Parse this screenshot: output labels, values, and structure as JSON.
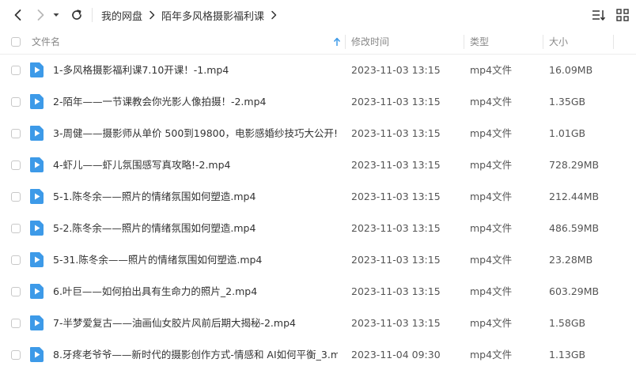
{
  "breadcrumb": [
    "我的网盘",
    "陌年多风格摄影福利课"
  ],
  "header": {
    "name": "文件名",
    "time": "修改时间",
    "type": "类型",
    "size": "大小"
  },
  "colors": {
    "file_icon": "#3d9ae8",
    "text": "#333333",
    "header_text": "#888888"
  },
  "icons": {
    "back": "chevron-left-icon",
    "forward": "chevron-right-icon",
    "history": "dropdown-icon",
    "refresh": "refresh-icon",
    "sort": "sort-list-icon",
    "file": "video-file-icon"
  },
  "files": [
    {
      "name": "1-多风格摄影福利课7.10开课！-1.mp4",
      "time": "2023-11-03 13:15",
      "type": "mp4文件",
      "size": "16.09MB"
    },
    {
      "name": "2-陌年——一节课教会你光影人像拍摄！-2.mp4",
      "time": "2023-11-03 13:15",
      "type": "mp4文件",
      "size": "1.35GB"
    },
    {
      "name": "3-周健——摄影师从单价 500到19800，电影感婚纱技巧大公开!-...",
      "time": "2023-11-03 13:15",
      "type": "mp4文件",
      "size": "1.01GB"
    },
    {
      "name": "4-虾儿——虾儿氛围感写真攻略!-2.mp4",
      "time": "2023-11-03 13:15",
      "type": "mp4文件",
      "size": "728.29MB"
    },
    {
      "name": "5-1.陈冬余——照片的情绪氛围如何塑造.mp4",
      "time": "2023-11-03 13:15",
      "type": "mp4文件",
      "size": "212.44MB"
    },
    {
      "name": "5-2.陈冬余——照片的情绪氛围如何塑造.mp4",
      "time": "2023-11-03 13:15",
      "type": "mp4文件",
      "size": "486.59MB"
    },
    {
      "name": "5-31.陈冬余——照片的情绪氛围如何塑造.mp4",
      "time": "2023-11-03 13:15",
      "type": "mp4文件",
      "size": "23.28MB"
    },
    {
      "name": "6.叶巨——如何拍出具有生命力的照片_2.mp4",
      "time": "2023-11-03 13:15",
      "type": "mp4文件",
      "size": "603.29MB"
    },
    {
      "name": "7-半梦爱复古——油画仙女胶片风前后期大揭秘-2.mp4",
      "time": "2023-11-03 13:15",
      "type": "mp4文件",
      "size": "1.58GB"
    },
    {
      "name": "8.牙疼老爷爷——新时代的摄影创作方式-情感和 AI如何平衡_3.m...",
      "time": "2023-11-04 09:30",
      "type": "mp4文件",
      "size": "1.13GB"
    }
  ]
}
